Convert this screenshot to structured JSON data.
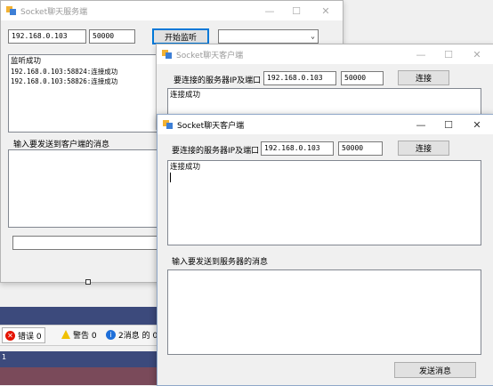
{
  "ide": {
    "errors_label": "错误 0",
    "warnings_label": "警告 0",
    "messages_label": "2消息 的 0",
    "line_number": "1"
  },
  "server": {
    "title": "Socket聊天服务端",
    "ip": "192.168.0.103",
    "port": "50000",
    "listen_button": "开始监听",
    "client_select_value": "",
    "log_lines": [
      "监听成功",
      "192.168.0.103:58824:连接成功",
      "192.168.0.103:58826:连接成功"
    ],
    "send_label": "输入要发送到客户端的消息",
    "message": "",
    "bottom_input": ""
  },
  "client_back": {
    "title": "Socket聊天客户端",
    "ip_label": "要连接的服务器IP及端口",
    "ip": "192.168.0.103",
    "port": "50000",
    "connect_button": "连接",
    "log_lines": [
      "连接成功"
    ]
  },
  "client_front": {
    "title": "Socket聊天客户端",
    "ip_label": "要连接的服务器IP及端口",
    "ip": "192.168.0.103",
    "port": "50000",
    "connect_button": "连接",
    "log_lines": [
      "连接成功"
    ],
    "send_label": "输入要发送到服务器的消息",
    "message": "",
    "send_button": "发送消息"
  },
  "window_controls": {
    "minimize": "—",
    "maximize": "☐",
    "close": "✕"
  },
  "colors": {
    "ide_blue": "#3c4a7c",
    "ide_blue_dark": "#2e3a68",
    "ide_bar_bg": "#f0f0f0",
    "ide_red": "#7a4a5a"
  }
}
